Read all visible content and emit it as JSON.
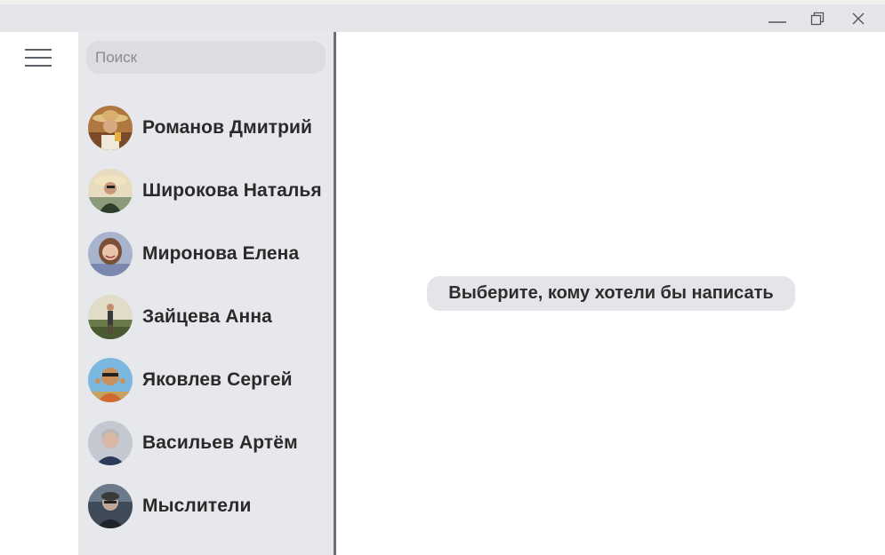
{
  "window": {
    "controls": {
      "minimize_icon": "minimize-icon",
      "maximize_icon": "restore-icon",
      "close_icon": "close-icon"
    }
  },
  "rail": {
    "menu_icon": "hamburger-menu-icon"
  },
  "search": {
    "placeholder": "Поиск",
    "value": ""
  },
  "contacts": [
    {
      "name": "Романов Дмитрий",
      "avatar_icon": "avatar-man-straw-hat",
      "colors": [
        "#c08a4a",
        "#5a3a24",
        "#e8c9a0"
      ]
    },
    {
      "name": "Широкова Наталья",
      "avatar_icon": "avatar-woman-sunhat",
      "colors": [
        "#e6d3a8",
        "#3d4a3a",
        "#7a6a4a"
      ]
    },
    {
      "name": "Миронова Елена",
      "avatar_icon": "avatar-woman-smiling",
      "colors": [
        "#a8b0c8",
        "#6a4a3a",
        "#e8c0a8"
      ]
    },
    {
      "name": "Зайцева Анна",
      "avatar_icon": "avatar-woman-field",
      "colors": [
        "#d8d2b8",
        "#4a5a3a",
        "#6a4a3a"
      ]
    },
    {
      "name": "Яковлев Сергей",
      "avatar_icon": "avatar-man-sunglasses",
      "colors": [
        "#6ab0d8",
        "#c07a3a",
        "#3a3a3a"
      ]
    },
    {
      "name": "Васильев Артём",
      "avatar_icon": "avatar-man-gray-hair",
      "colors": [
        "#b8bcc4",
        "#2a3a5a",
        "#d0b0a0"
      ]
    },
    {
      "name": "Мыслители",
      "avatar_icon": "avatar-group-thinkers",
      "colors": [
        "#4a5a6a",
        "#b0b8c0",
        "#2a2a2a"
      ]
    }
  ],
  "main": {
    "empty_hint": "Выберите, кому хотели бы написать"
  }
}
